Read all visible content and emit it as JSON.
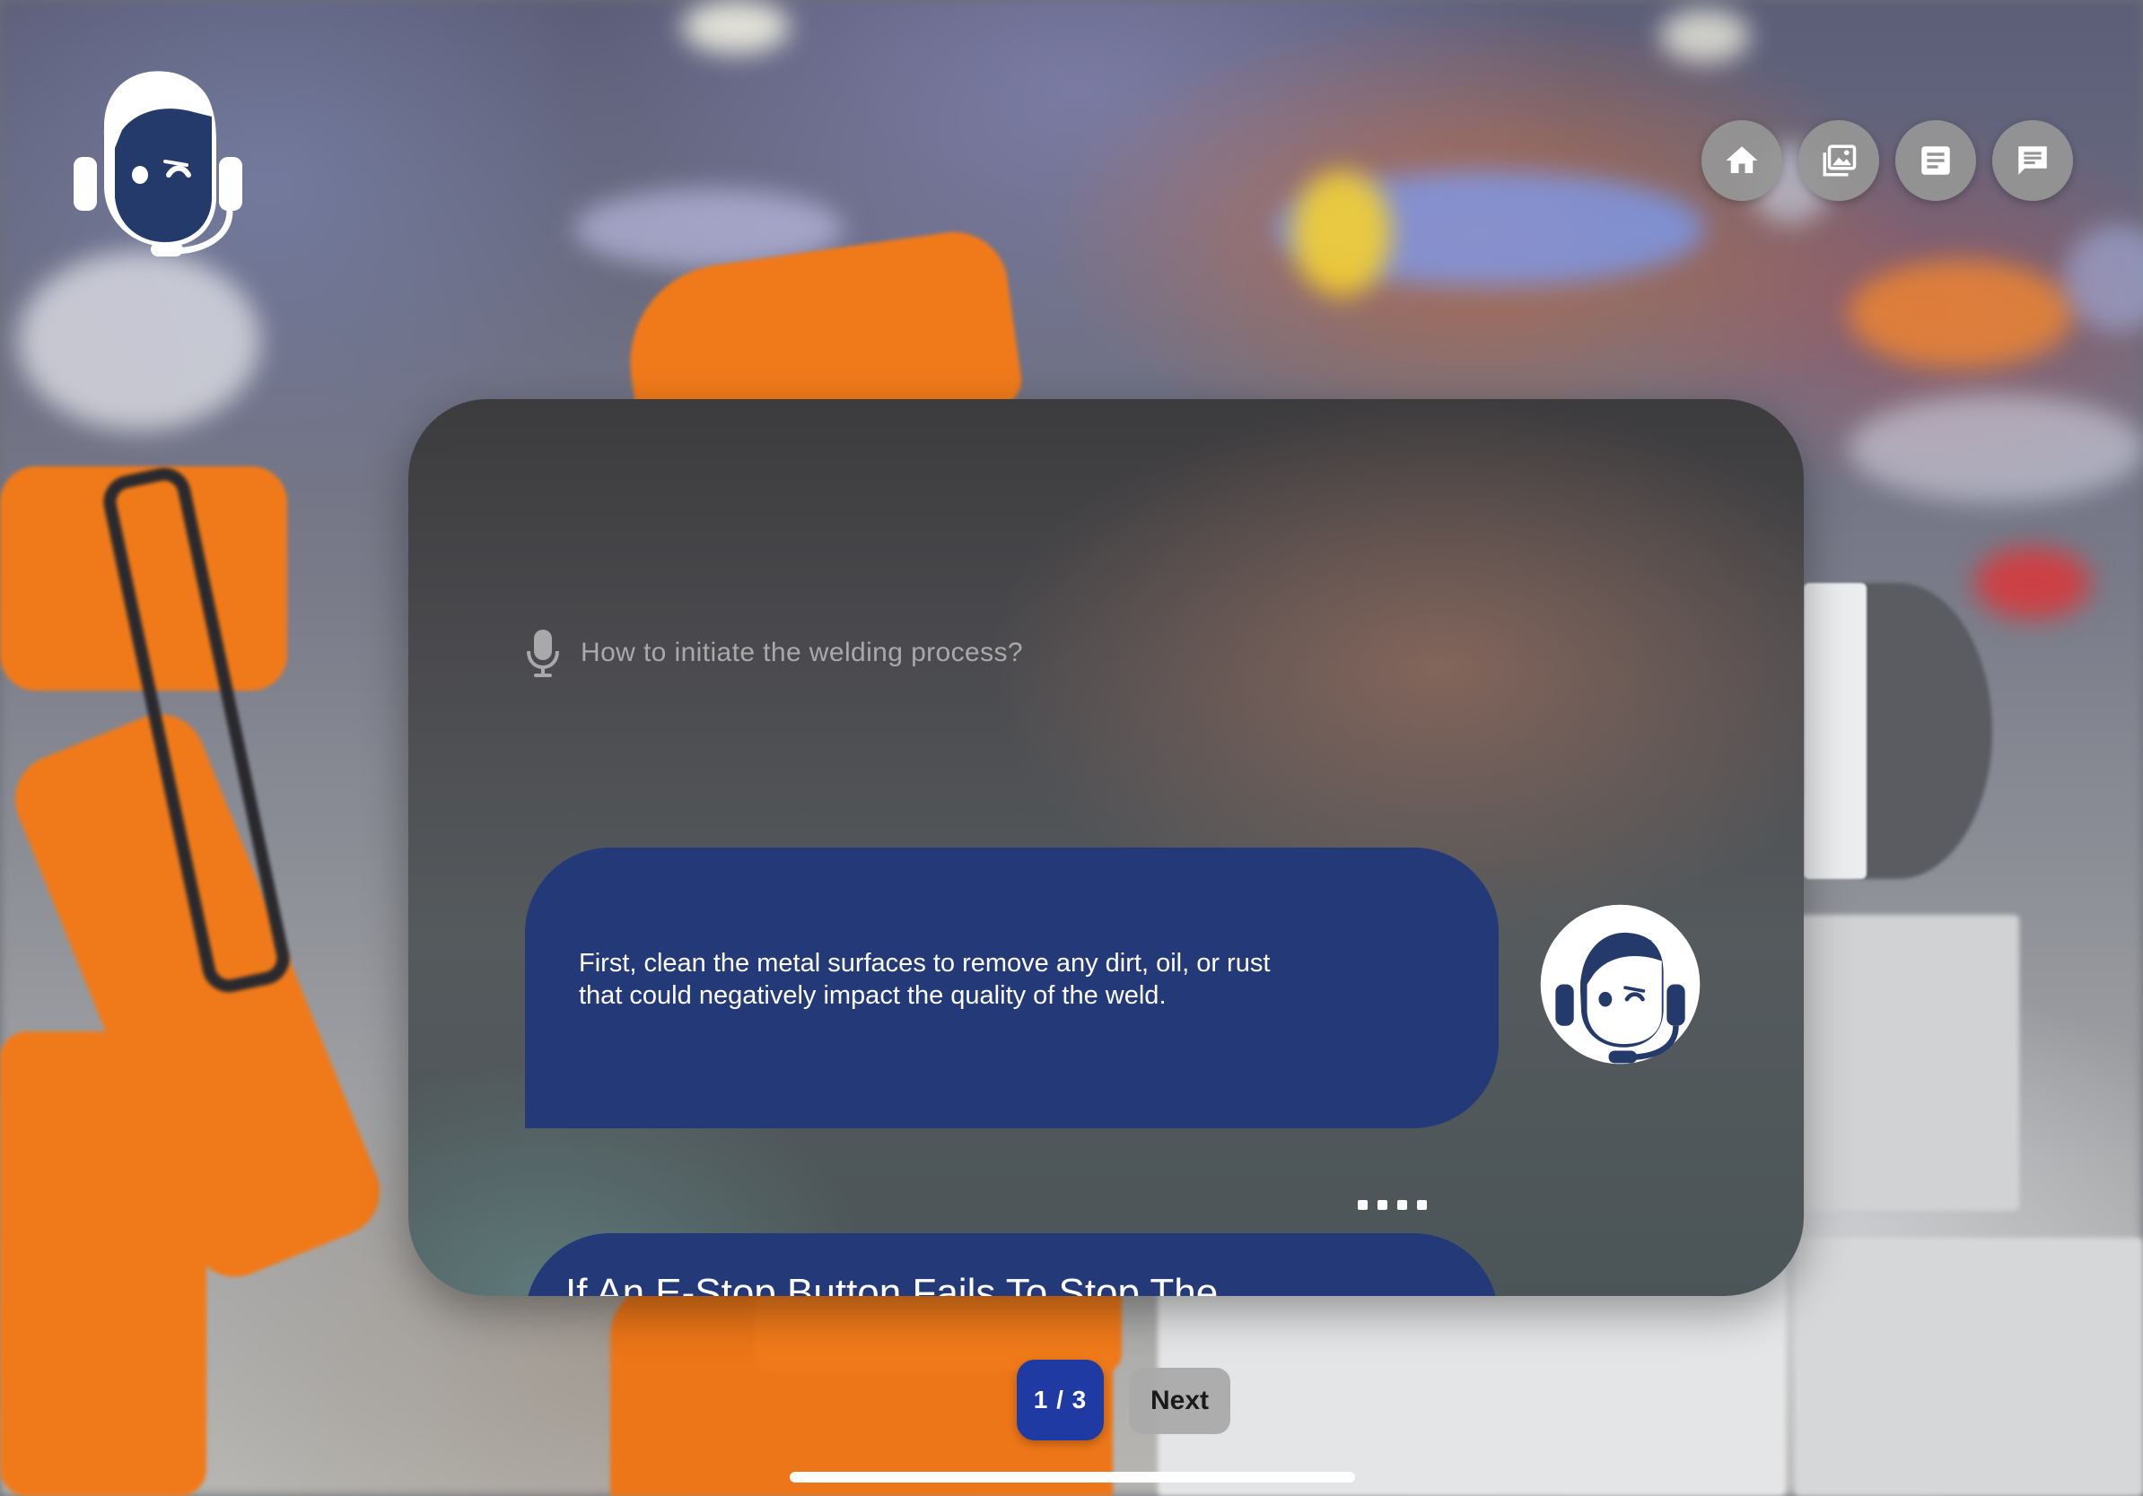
{
  "assistant": {
    "logo_icon": "headset-agent-icon"
  },
  "nav": {
    "items": [
      {
        "icon": "home-icon"
      },
      {
        "icon": "gallery-icon"
      },
      {
        "icon": "document-icon"
      },
      {
        "icon": "chat-icon"
      }
    ]
  },
  "conversation": {
    "query_icon": "microphone-icon",
    "query": "How to initiate the welding process?",
    "reply": "First,  clean the metal surfaces to remove any dirt, oil, or rust\nthat could negatively impact the quality of the weld.",
    "reply_avatar_icon": "headset-agent-icon",
    "typing_indicator": "....",
    "next_reply_partial": "If An E-Stop Button Fails To Stop The"
  },
  "pagination": {
    "indicator": "1 / 3",
    "next_label": "Next"
  },
  "colors": {
    "bubble": "#243978",
    "page_indicator": "#1f3aa3",
    "nav_button": "#969696",
    "mascot_navy": "#233a6b"
  }
}
